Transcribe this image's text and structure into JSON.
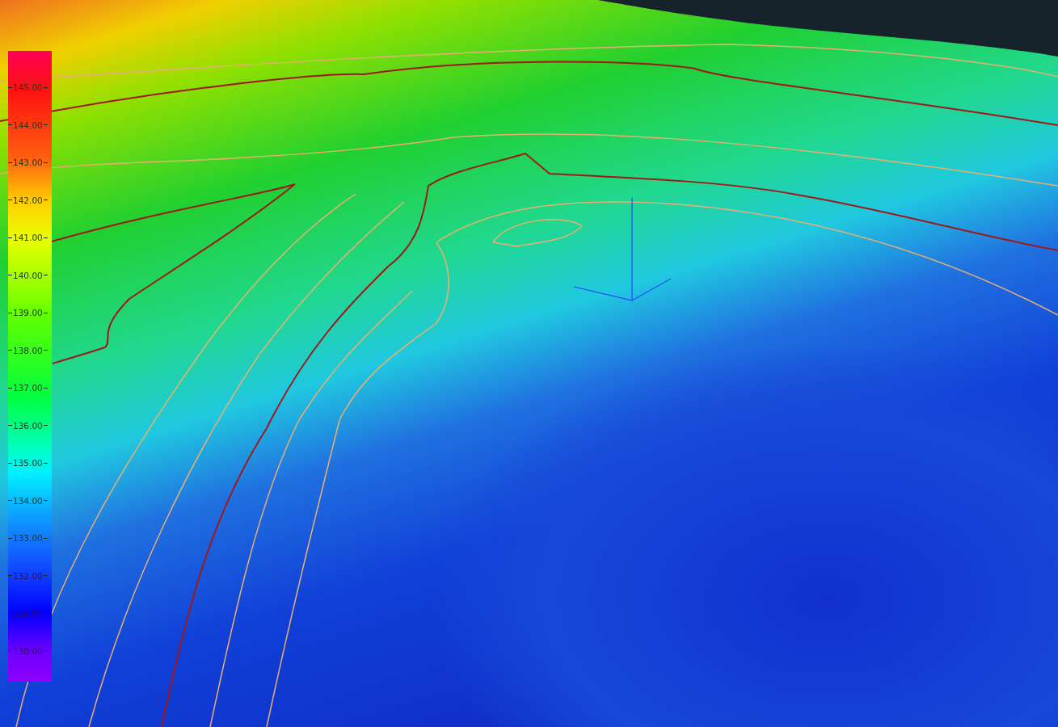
{
  "legend": {
    "labels": [
      "145.00",
      "144.00",
      "143.00",
      "142.00",
      "141.00",
      "140.00",
      "139.00",
      "138.00",
      "137.00",
      "136.00",
      "135.00",
      "134.00",
      "133.00",
      "132.00",
      "131.00",
      "130.00"
    ]
  }
}
